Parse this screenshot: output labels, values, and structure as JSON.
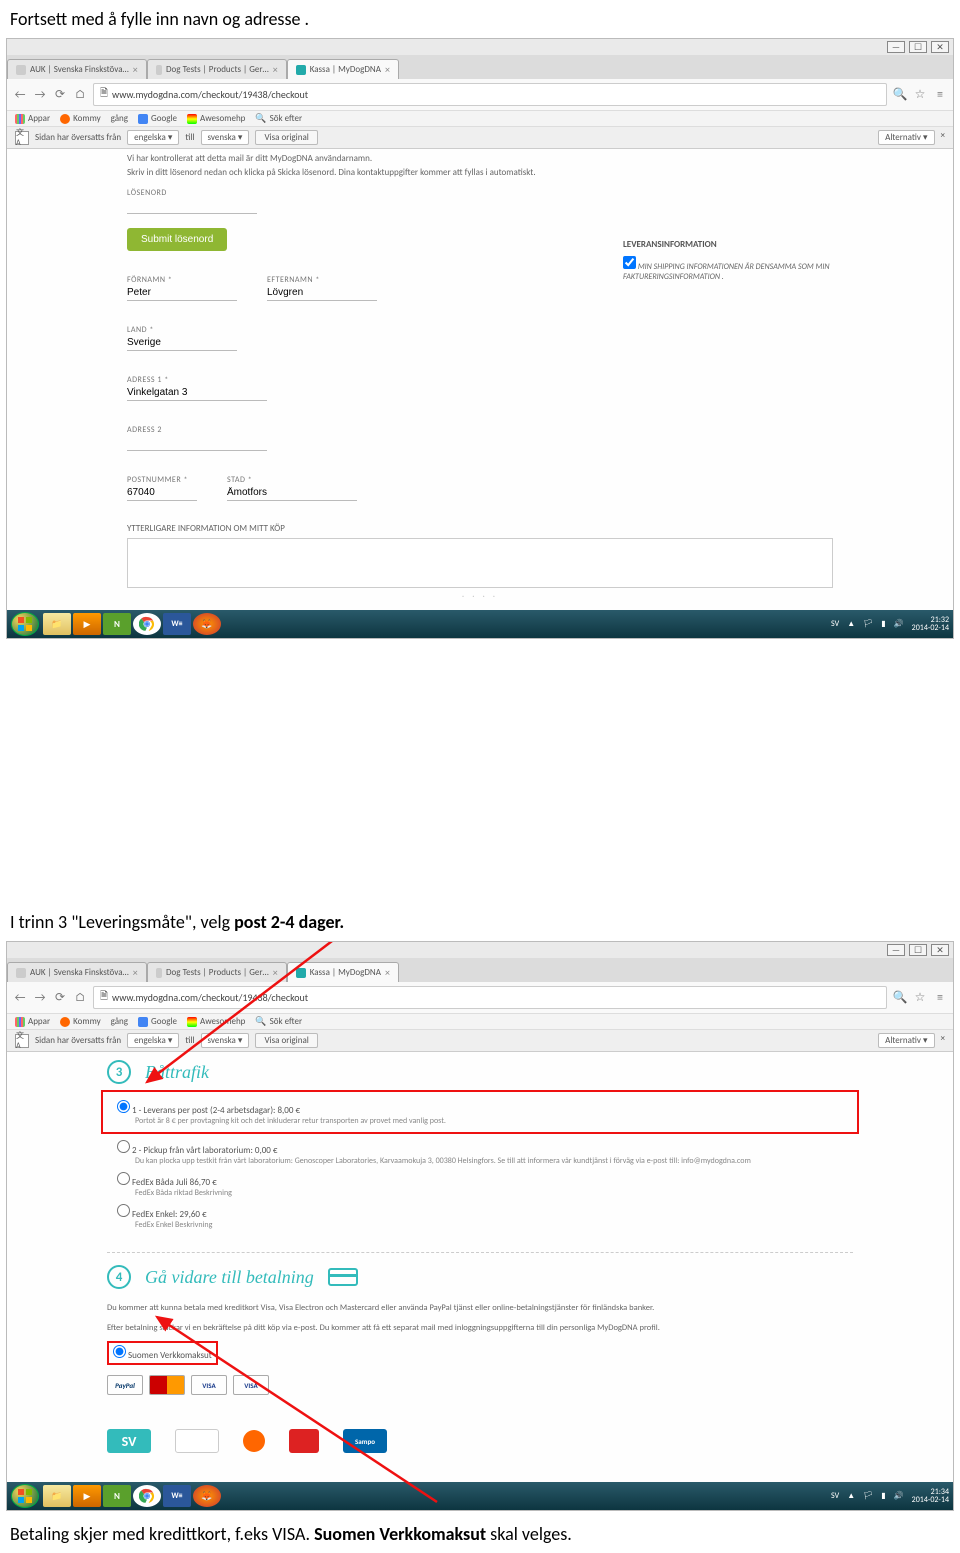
{
  "doc": {
    "line1": "Fortsett med å fylle inn navn og adresse .",
    "line2_a": "I trinn 3 \"Leveringsmåte\", velg ",
    "line2_b": "post 2-4 dager.",
    "line3_a": "Betaling skjer med kredittkort, f.eks VISA.  ",
    "line3_b": "Suomen Verkkomaksut",
    "line3_c": " skal velges."
  },
  "browser": {
    "tabs": [
      {
        "label": "AUK | Svenska Finskstöva…",
        "active": false
      },
      {
        "label": "Dog Tests | Products | Ger…",
        "active": false
      },
      {
        "label": "Kassa | MyDogDNA",
        "active": true
      }
    ],
    "url": "www.mydogdna.com/checkout/19438/checkout",
    "bookmarks": {
      "apps": "Appar",
      "kommy": "Kommy",
      "gang": "gång",
      "google": "Google",
      "awesome": "Awesomehp",
      "search": "Sök efter"
    },
    "translate": {
      "text": "Sidan har översatts från",
      "from": "engelska",
      "till": "till",
      "to": "svenska",
      "show_orig": "Visa original",
      "alternativ": "Alternativ"
    },
    "right_icons": {
      "search": "🔍",
      "star": "☆",
      "menu": "≡"
    }
  },
  "page1": {
    "info1": "Vi har kontrollerat att detta mail är ditt MyDogDNA användarnamn.",
    "info2": "Skriv in ditt lösenord nedan och klicka på Skicka lösenord. Dina kontaktuppgifter kommer att fyllas i automatiskt.",
    "password_label": "LÖSENORD",
    "submit": "Submit lösenord",
    "fornamn_label": "FÖRNAMN *",
    "fornamn": "Peter",
    "efternamn_label": "EFTERNAMN *",
    "efternamn": "Lövgren",
    "land_label": "LAND *",
    "land": "Sverige",
    "adress1_label": "ADRESS 1 *",
    "adress1": "Vinkelgatan 3",
    "adress2_label": "ADRESS 2",
    "postnr_label": "POSTNUMMER *",
    "postnr": "67040",
    "stad_label": "STAD *",
    "stad": "Åmotfors",
    "delivery_title": "LEVERANSINFORMATION",
    "delivery_ck": "MIN SHIPPING INFORMATIONEN ÄR DENSAMMA SOM MIN FAKTURERINGSINFORMATION .",
    "addl": "YTTERLIGARE INFORMATION OM MITT KÖP"
  },
  "taskbar1": {
    "lang": "SV",
    "time": "21:32",
    "date": "2014-02-14"
  },
  "taskbar2": {
    "lang": "SV",
    "time": "21:34",
    "date": "2014-02-14"
  },
  "page2": {
    "step3_title": "Båttrafik",
    "opt1": "1 - Leverans per post (2-4 arbetsdagar): 8,00 €",
    "opt1_desc": "Portot är 8 € per provtagning kit och det inkluderar retur transporten av provet med vanlig post.",
    "opt2": "2 - Pickup från vårt laboratorium: 0,00 €",
    "opt2_desc": "Du kan plocka upp testkit från vårt laboratorium: Genoscoper Laboratories, Karvaamokuja 3, 00380 Helsingfors. Se till att informera vår kundtjänst i förväg via e-post till: info@mydogdna.com",
    "opt3": "FedEx Båda Juli 86,70 €",
    "opt3_desc": "FedEx Båda riktad Beskrivning",
    "opt4": "FedEx Enkel: 29,60 €",
    "opt4_desc": "FedEx Enkel Beskrivning",
    "step4_title": "Gå vidare till betalning",
    "pay_info1": "Du kommer att kunna betala med kreditkort Visa, Visa Electron och Mastercard eller använda PayPal tjänst eller online-betalningstjänster för finländska banker.",
    "pay_info2": "Efter betalning skickar vi en bekräftelse på ditt köp via e-post. Du kommer att få ett separat mail med inloggningsuppgifterna till din personliga MyDogDNA profil.",
    "suomen": "Suomen Verkkomaksut",
    "logos": {
      "paypal": "PayPal",
      "mc": "",
      "visa": "VISA",
      "visae": "VISA"
    },
    "banks": {
      "sv": "SV",
      "np": "",
      "op": "",
      "danske": "",
      "sampo": "Sampo"
    }
  }
}
